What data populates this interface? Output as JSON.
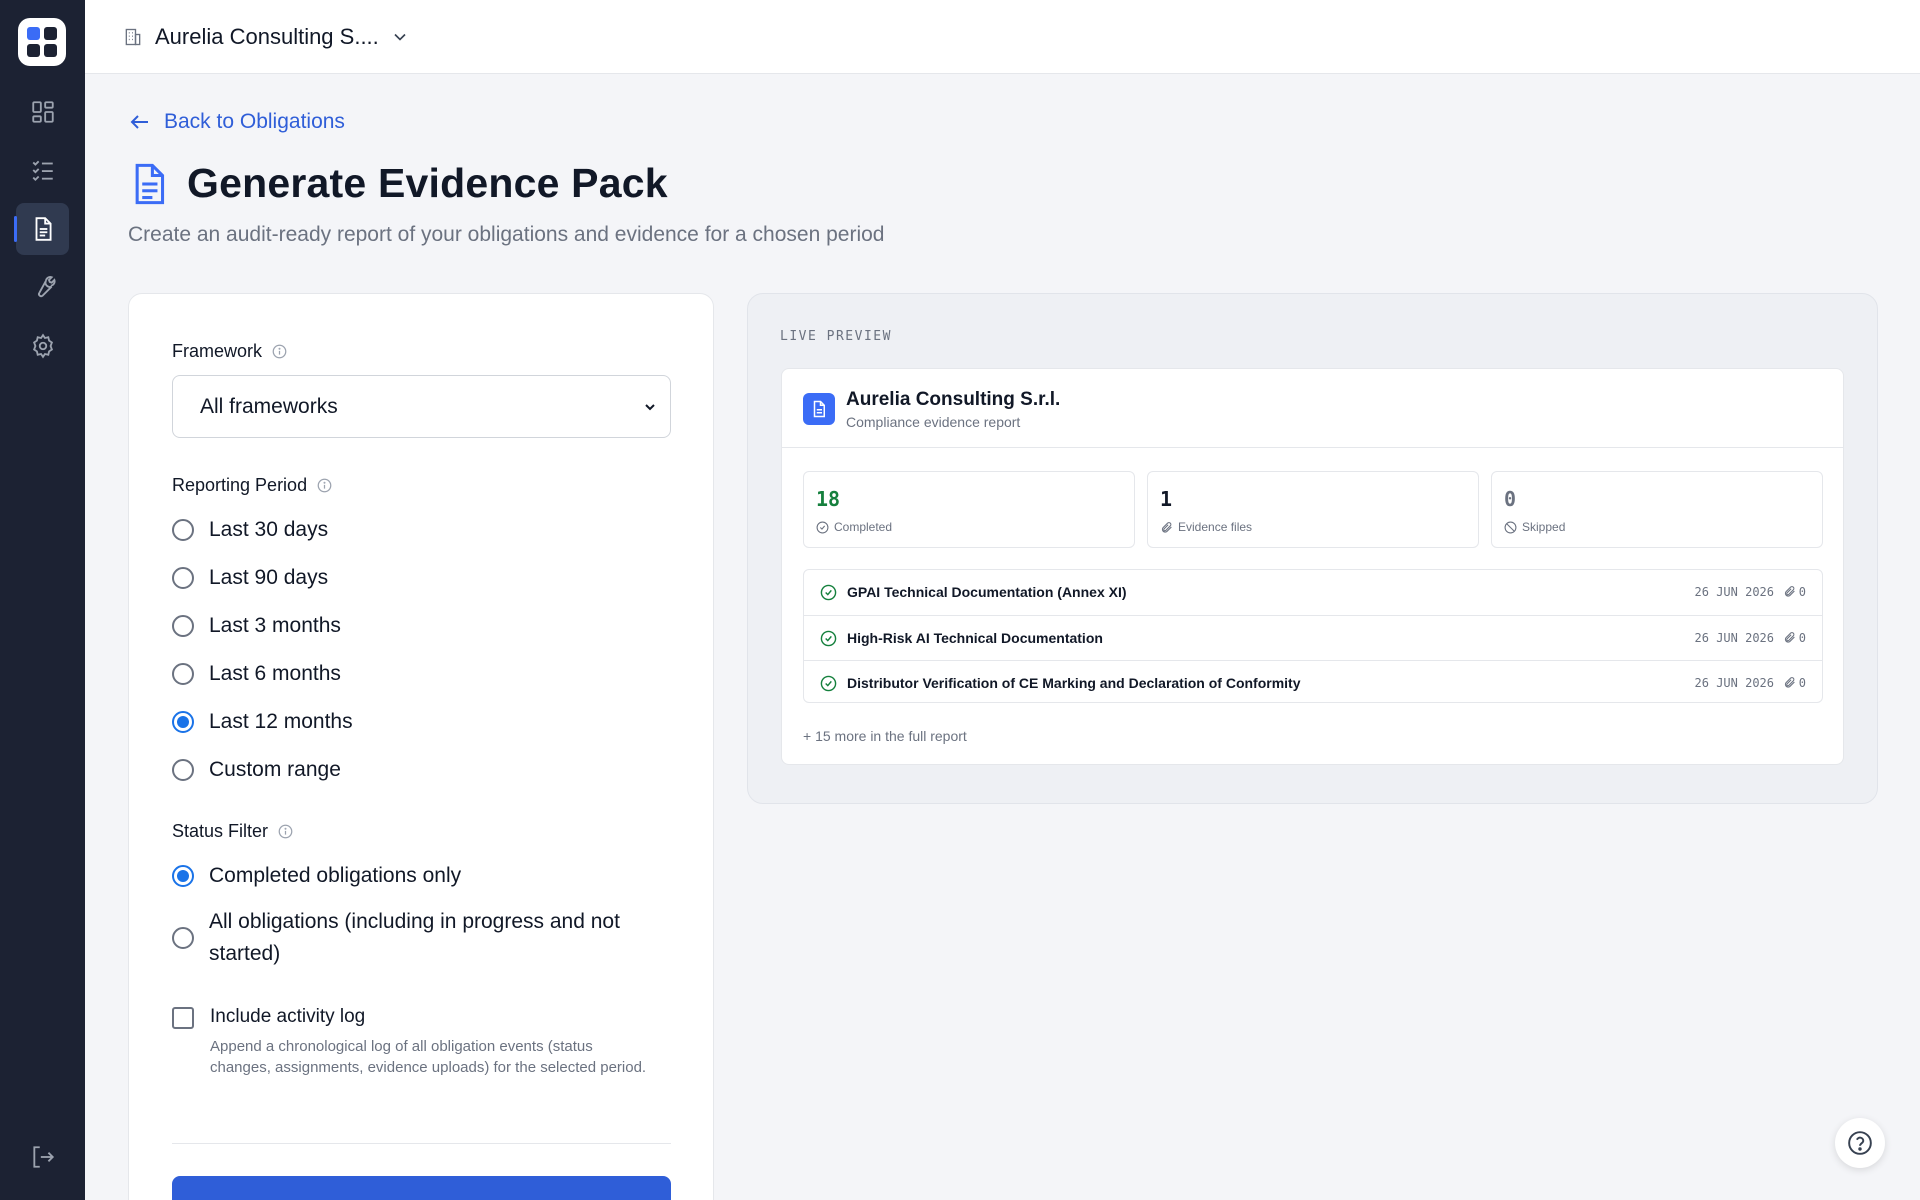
{
  "org": {
    "name": "Aurelia Consulting S...."
  },
  "header": {
    "back_label": "Back to Obligations",
    "title": "Generate Evidence Pack",
    "subtitle": "Create an audit-ready report of your obligations and evidence for a chosen period"
  },
  "form": {
    "framework": {
      "label": "Framework",
      "selected": "All frameworks"
    },
    "period": {
      "label": "Reporting Period",
      "options": [
        "Last 30 days",
        "Last 90 days",
        "Last 3 months",
        "Last 6 months",
        "Last 12 months",
        "Custom range"
      ],
      "selected": "Last 12 months"
    },
    "status": {
      "label": "Status Filter",
      "options": [
        "Completed obligations only",
        "All obligations (including in progress and not started)"
      ],
      "selected": "Completed obligations only"
    },
    "activity_log": {
      "label": "Include activity log",
      "help": "Append a chronological log of all obligation events (status changes, assignments, evidence uploads) for the selected period.",
      "checked": false
    },
    "submit_label": ""
  },
  "preview": {
    "label": "LIVE PREVIEW",
    "org_name": "Aurelia Consulting S.r.l.",
    "report_type": "Compliance evidence report",
    "stats": [
      {
        "value": "18",
        "label": "Completed",
        "color": "#15803d"
      },
      {
        "value": "1",
        "label": "Evidence files",
        "color": "#111827"
      },
      {
        "value": "0",
        "label": "Skipped",
        "color": "#6b7280"
      }
    ],
    "items": [
      {
        "title": "GPAI Technical Documentation (Annex XI)",
        "date": "26 JUN 2026",
        "files": "0"
      },
      {
        "title": "High-Risk AI Technical Documentation",
        "date": "26 JUN 2026",
        "files": "0"
      },
      {
        "title": "Distributor Verification of CE Marking and Declaration of Conformity",
        "date": "26 JUN 2026",
        "files": "0"
      }
    ],
    "more": "+ 15 more in the full report"
  },
  "colors": {
    "accent": "#2f5ed8",
    "sidebar": "#1c2233",
    "success": "#15803d"
  }
}
